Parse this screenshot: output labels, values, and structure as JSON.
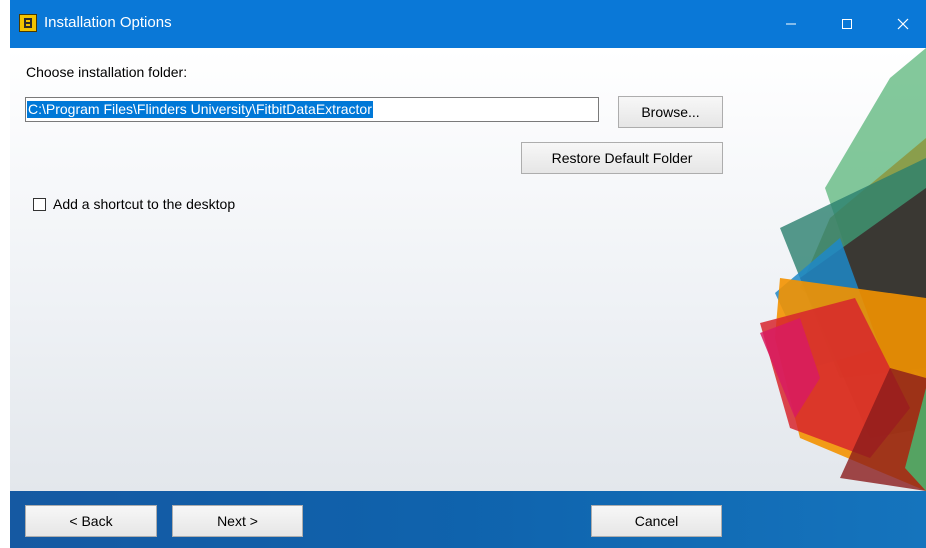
{
  "window": {
    "title": "Installation Options",
    "app_icon": "installer-app-icon",
    "title_bar_color": "#0a78d7"
  },
  "title_controls": {
    "minimize_icon": "minimize-icon",
    "maximize_icon": "maximize-icon",
    "close_icon": "close-icon"
  },
  "main": {
    "folder_label": "Choose installation folder:",
    "folder_path": "C:\\Program Files\\Flinders University\\FitbitDataExtractor",
    "browse_label": "Browse...",
    "restore_label": "Restore Default Folder",
    "shortcut_label": "Add a shortcut to the desktop",
    "shortcut_checked": false
  },
  "footer": {
    "back_label": "< Back",
    "next_label": "Next >",
    "cancel_label": "Cancel",
    "background_color": "#0f63ad"
  },
  "colors": {
    "selection": "#0078d7",
    "accent_green": "#4caf6a",
    "accent_orange": "#f39200",
    "accent_red": "#d7262d",
    "accent_blue": "#1e88c8",
    "accent_magenta": "#d81b60"
  }
}
